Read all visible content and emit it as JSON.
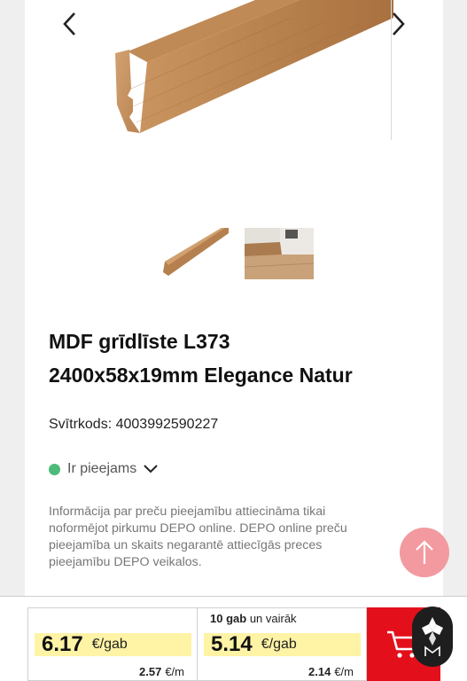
{
  "product": {
    "title_line1": "MDF grīdlīste L373",
    "title_line2": "2400x58x19mm Elegance Natur",
    "barcode_label": "Svītrkods:",
    "barcode_value": "4003992590227",
    "availability": "Ir pieejams",
    "notice": "Informācija par preču pieejamību attiecināma tikai noformējot pirkumu DEPO online. DEPO online preču pieejamība  un skaits negarantē attiecīgās preces pieejamību DEPO veikalos."
  },
  "pricing": {
    "unit_price": {
      "value": "6.17",
      "unit": "€/gab",
      "per_m_value": "2.57",
      "per_m_unit": "€/m"
    },
    "bulk_price": {
      "qty": "10 gab",
      "qty_suffix": "un vairāk",
      "value": "5.14",
      "unit": "€/gab",
      "per_m_value": "2.14",
      "per_m_unit": "€/m"
    }
  },
  "icons": {
    "prev": "chevron-left-icon",
    "next": "chevron-right-icon",
    "availability_toggle": "chevron-down-icon",
    "scroll_top": "arrow-up-icon",
    "cart": "shopping-cart-icon",
    "logo": "logo-badge"
  },
  "colors": {
    "accent_red": "#e3101b",
    "available_green": "#4cbb7a",
    "price_highlight": "#fff3a6",
    "scroll_top_pink": "#f29aa0"
  }
}
